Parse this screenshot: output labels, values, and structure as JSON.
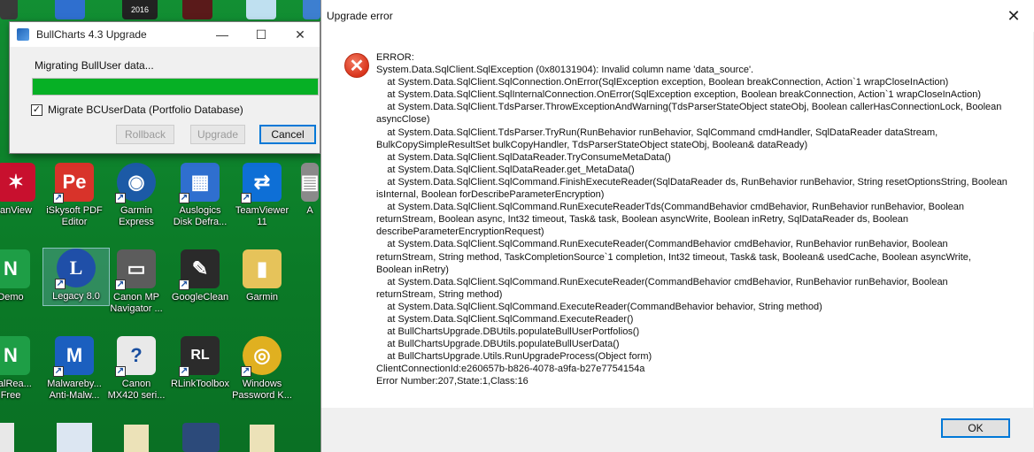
{
  "bullcharts_window": {
    "title": "BullCharts 4.3 Upgrade",
    "status_text": "Migrating BullUser data...",
    "progress_fraction": 1.0,
    "checkbox_label": "Migrate BCUserData (Portfolio Database)",
    "checkbox_checked": true,
    "buttons": {
      "rollback": "Rollback",
      "upgrade": "Upgrade",
      "cancel": "Cancel"
    },
    "caption_buttons": {
      "minimize": "—",
      "maximize": "☐",
      "close": "✕"
    }
  },
  "error_dialog": {
    "title": "Upgrade error",
    "close_glyph": "✕",
    "icon_glyph": "✕",
    "ok_label": "OK",
    "lines": [
      "ERROR:",
      "System.Data.SqlClient.SqlException (0x80131904): Invalid column name 'data_source'.",
      "    at System.Data.SqlClient.SqlConnection.OnError(SqlException exception, Boolean breakConnection, Action`1 wrapCloseInAction)",
      "    at System.Data.SqlClient.SqlInternalConnection.OnError(SqlException exception, Boolean breakConnection, Action`1 wrapCloseInAction)",
      "    at System.Data.SqlClient.TdsParser.ThrowExceptionAndWarning(TdsParserStateObject stateObj, Boolean callerHasConnectionLock, Boolean",
      "asyncClose)",
      "    at System.Data.SqlClient.TdsParser.TryRun(RunBehavior runBehavior, SqlCommand cmdHandler, SqlDataReader dataStream,",
      "BulkCopySimpleResultSet bulkCopyHandler, TdsParserStateObject stateObj, Boolean& dataReady)",
      "    at System.Data.SqlClient.SqlDataReader.TryConsumeMetaData()",
      "    at System.Data.SqlClient.SqlDataReader.get_MetaData()",
      "    at System.Data.SqlClient.SqlCommand.FinishExecuteReader(SqlDataReader ds, RunBehavior runBehavior, String resetOptionsString, Boolean",
      "isInternal, Boolean forDescribeParameterEncryption)",
      "    at System.Data.SqlClient.SqlCommand.RunExecuteReaderTds(CommandBehavior cmdBehavior, RunBehavior runBehavior, Boolean",
      "returnStream, Boolean async, Int32 timeout, Task& task, Boolean asyncWrite, Boolean inRetry, SqlDataReader ds, Boolean",
      "describeParameterEncryptionRequest)",
      "    at System.Data.SqlClient.SqlCommand.RunExecuteReader(CommandBehavior cmdBehavior, RunBehavior runBehavior, Boolean",
      "returnStream, String method, TaskCompletionSource`1 completion, Int32 timeout, Task& task, Boolean& usedCache, Boolean asyncWrite,",
      "Boolean inRetry)",
      "    at System.Data.SqlClient.SqlCommand.RunExecuteReader(CommandBehavior cmdBehavior, RunBehavior runBehavior, Boolean",
      "returnStream, String method)",
      "    at System.Data.SqlClient.SqlCommand.ExecuteReader(CommandBehavior behavior, String method)",
      "    at System.Data.SqlClient.SqlCommand.ExecuteReader()",
      "    at BullChartsUpgrade.DBUtils.populateBullUserPortfolios()",
      "    at BullChartsUpgrade.DBUtils.populateBullUserData()",
      "    at BullChartsUpgrade.Utils.RunUpgradeProcess(Object form)",
      "ClientConnectionId:e260657b-b826-4078-a9fa-b27e7754154a",
      "Error Number:207,State:1,Class:16"
    ]
  },
  "desktop": {
    "top_strip_label": "2016",
    "icons": [
      {
        "label": "anView",
        "glyph": "✶",
        "color": "#c8102e"
      },
      {
        "label": "iSkysoft PDF\nEditor",
        "glyph": "Pe",
        "color": "#d8332a"
      },
      {
        "label": "Garmin\nExpress",
        "glyph": "◉",
        "color": "#1c5aa6"
      },
      {
        "label": "Auslogics\nDisk Defra...",
        "glyph": "▦",
        "color": "#2f6fcf"
      },
      {
        "label": "TeamViewer\n11",
        "glyph": "⇄",
        "color": "#0e6fd6"
      },
      {
        "label": "A",
        "glyph": "▤",
        "color": "#8a8a8a"
      },
      {
        "label": "Demo",
        "glyph": "N",
        "color": "#1e9e46"
      },
      {
        "label": "Legacy 8.0",
        "glyph": "L",
        "color": "#1f4fa8"
      },
      {
        "label": "Canon MP\nNavigator ...",
        "glyph": "▭",
        "color": "#5c5c5c"
      },
      {
        "label": "GoogleClean",
        "glyph": "✎",
        "color": "#2a2a2a"
      },
      {
        "label": "Garmin",
        "glyph": "▮",
        "color": "#e6c35a"
      },
      {
        "label": "uralRea...\nFree",
        "glyph": "N",
        "color": "#1e9e46"
      },
      {
        "label": "Malwareby...\nAnti-Malw...",
        "glyph": "M",
        "color": "#1b5fbf"
      },
      {
        "label": "Canon\nMX420 seri...",
        "glyph": "?",
        "color": "#e9e9e9"
      },
      {
        "label": "RLinkToolbox",
        "glyph": "RL",
        "color": "#2b2b2b"
      },
      {
        "label": "Windows\nPassword K...",
        "glyph": "◎",
        "color": "#e0b020"
      }
    ]
  }
}
